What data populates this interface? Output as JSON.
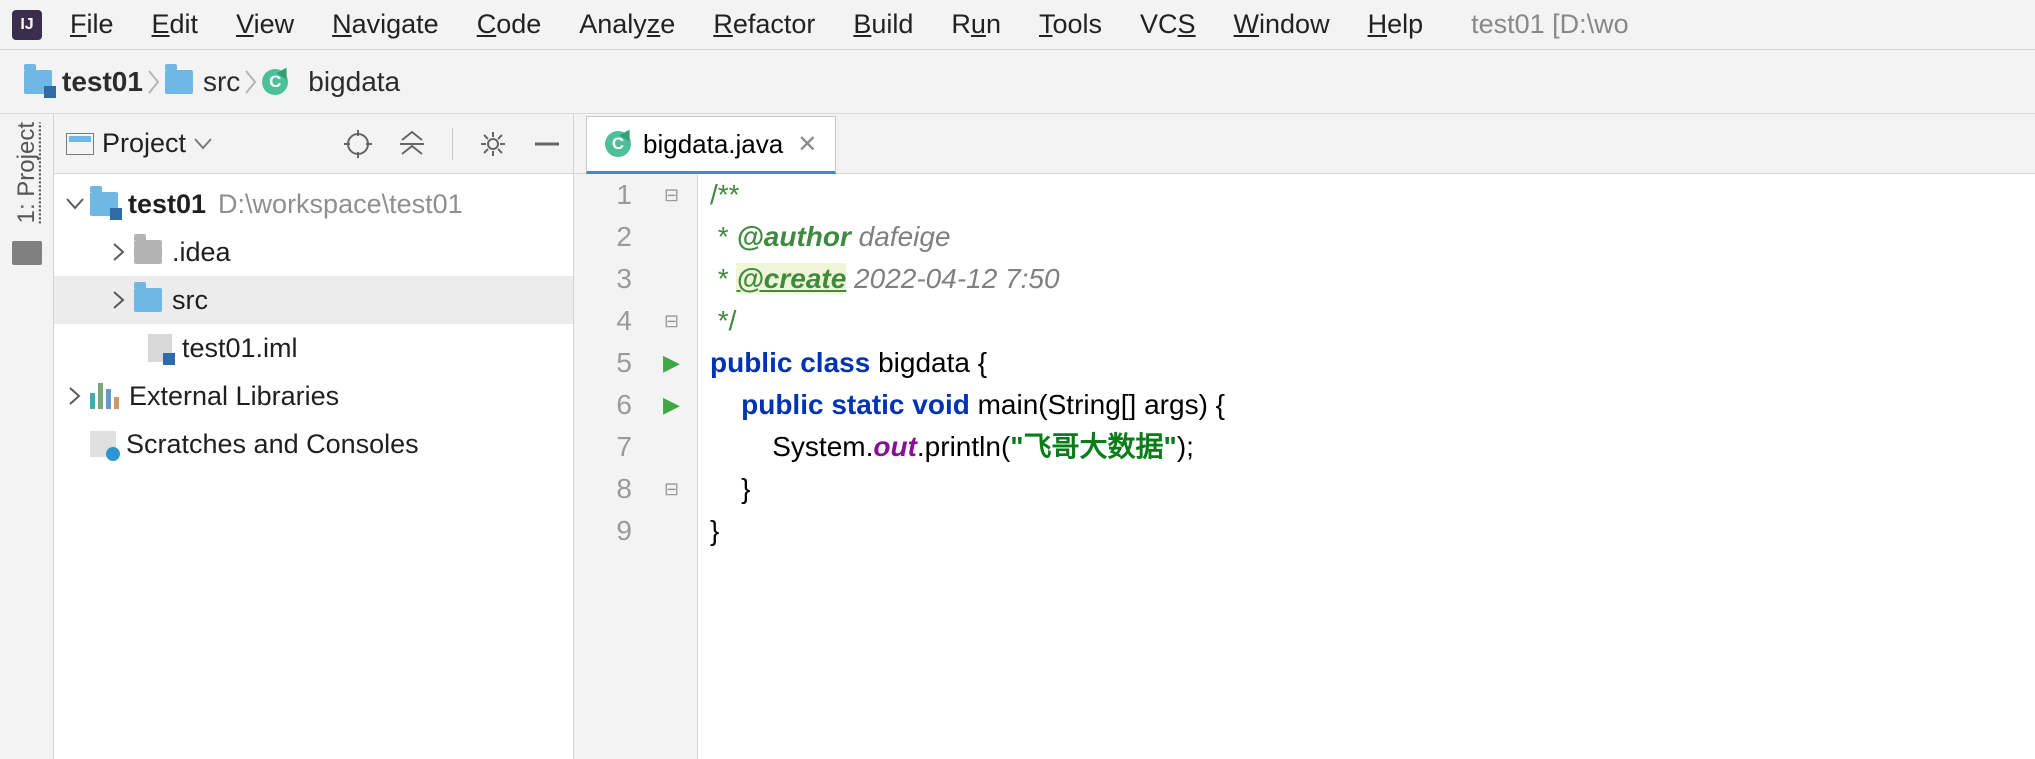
{
  "menu": {
    "items": [
      "File",
      "Edit",
      "View",
      "Navigate",
      "Code",
      "Analyze",
      "Refactor",
      "Build",
      "Run",
      "Tools",
      "VCS",
      "Window",
      "Help"
    ],
    "underlines": [
      "F",
      "E",
      "V",
      "N",
      "C",
      "z",
      "R",
      "B",
      "u",
      "T",
      "S",
      "W",
      "H"
    ]
  },
  "title_suffix": "test01 [D:\\wo",
  "breadcrumb": {
    "root": "test01",
    "mid": "src",
    "last": "bigdata"
  },
  "left_strip": {
    "label": "1: Project"
  },
  "project_panel": {
    "title": "Project",
    "tree": {
      "root_name": "test01",
      "root_path": "D:\\workspace\\test01",
      "idea": ".idea",
      "src": "src",
      "iml": "test01.iml",
      "ext": "External Libraries",
      "scratch": "Scratches and Consoles"
    }
  },
  "editor": {
    "tab_name": "bigdata.java",
    "code": {
      "l1": "/**",
      "l2_pre": " * ",
      "l2_tag": "@author",
      "l2_val": " dafeige",
      "l3_pre": " * ",
      "l3_tag": "@create",
      "l3_val": " 2022-04-12 7:50",
      "l4": " */",
      "l5_kw": "public class ",
      "l5_name": "bigdata {",
      "l6_kw": "public static void ",
      "l6_sig": "main(String[] args) {",
      "l7_a": "System.",
      "l7_b": "out",
      "l7_c": ".println(",
      "l7_str": "\"飞哥大数据\"",
      "l7_d": ");",
      "l8": "}",
      "l9": "}"
    }
  }
}
